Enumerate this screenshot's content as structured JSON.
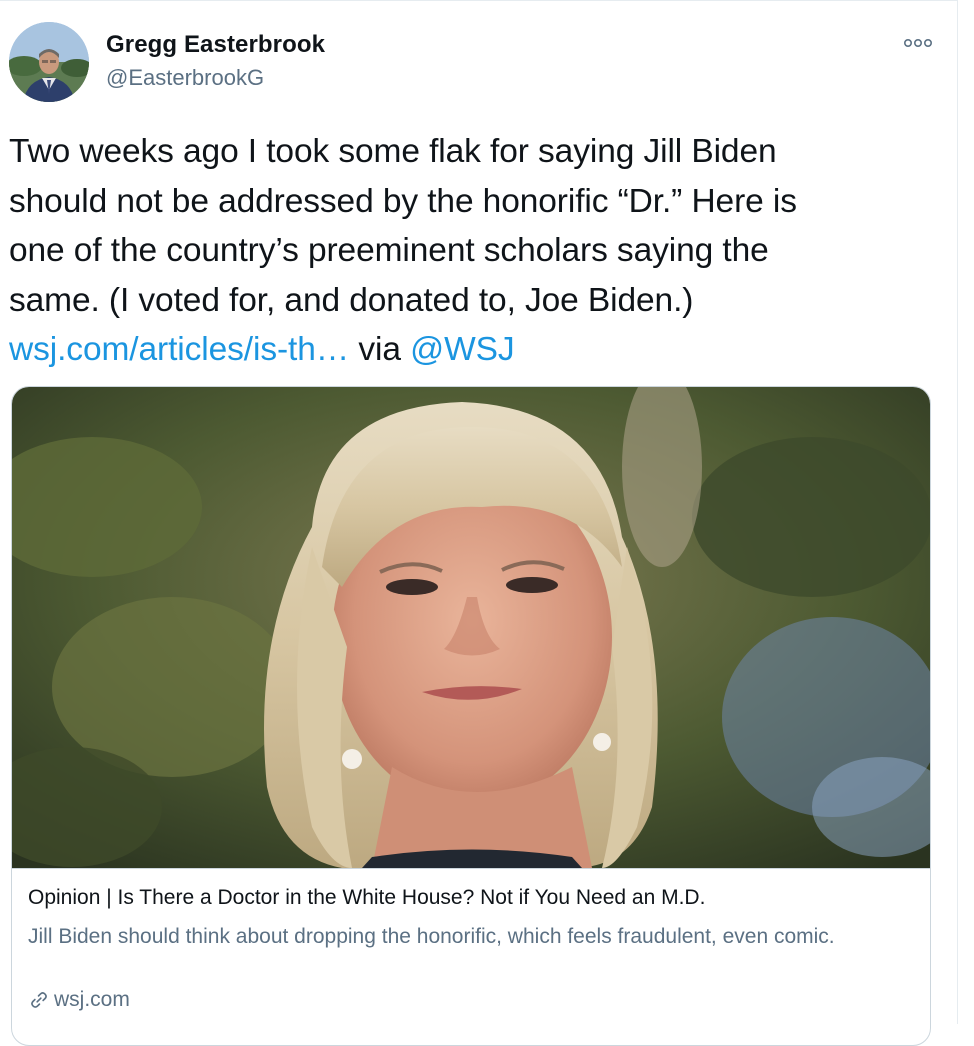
{
  "author": {
    "name": "Gregg Easterbrook",
    "handle": "@EasterbrookG"
  },
  "tweet": {
    "lines": [
      "Two weeks ago I took some flak for saying Jill Biden",
      "should not be addressed by the honorific “Dr.” Here is",
      "one of the country’s preeminent scholars saying the",
      "same. (I voted for, and donated to, Joe Biden.)"
    ],
    "link_text": "wsj.com/articles/is-th…",
    "via_text": " via ",
    "mention": "@WSJ"
  },
  "card": {
    "title": "Opinion | Is There a Doctor in the White House? Not if You Need an M.D.",
    "description": "Jill Biden should think about dropping the honorific, which feels fraudulent, even comic.",
    "domain": "wsj.com"
  },
  "icons": {
    "more": "more-horizontal-icon",
    "link": "link-icon"
  },
  "colors": {
    "link": "#1b95e0",
    "secondary_text": "#5b7083",
    "border": "#ccd6dd"
  }
}
